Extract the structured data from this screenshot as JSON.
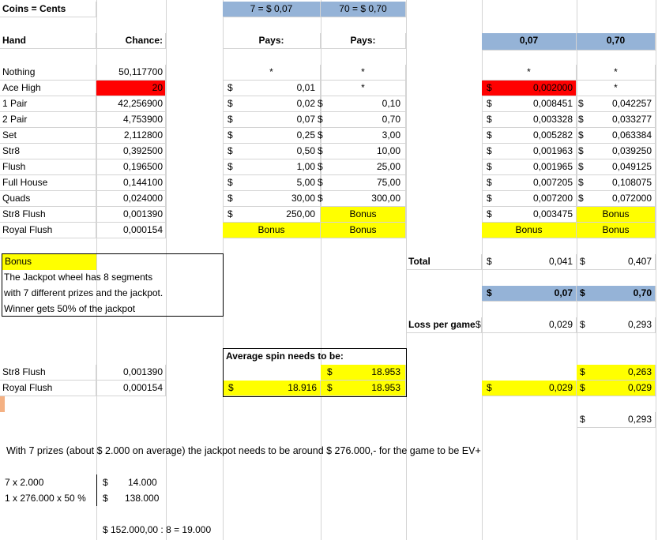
{
  "header": {
    "coins_label": "Coins = Cents",
    "rate_1": "7 = $ 0,07",
    "rate_2": "70 = $ 0,70"
  },
  "columns": {
    "hand": "Hand",
    "chance": "Chance:",
    "pays_1": "Pays:",
    "pays_2": "Pays:",
    "ev_1": "0,07",
    "ev_2": "0,70"
  },
  "rows": [
    {
      "hand": "Nothing",
      "chance": "50,117700",
      "pay1": "*",
      "pay2": "*",
      "ev1": "*",
      "ev2": "*"
    },
    {
      "hand": "Ace High",
      "chance": "20",
      "pay1": "0,01",
      "pay2": "*",
      "ev1": "0,002000",
      "ev2": "*"
    },
    {
      "hand": "1 Pair",
      "chance": "42,256900",
      "pay1": "0,02",
      "pay2": "0,10",
      "ev1": "0,008451",
      "ev2": "0,042257"
    },
    {
      "hand": "2 Pair",
      "chance": "4,753900",
      "pay1": "0,07",
      "pay2": "0,70",
      "ev1": "0,003328",
      "ev2": "0,033277"
    },
    {
      "hand": "Set",
      "chance": "2,112800",
      "pay1": "0,25",
      "pay2": "3,00",
      "ev1": "0,005282",
      "ev2": "0,063384"
    },
    {
      "hand": "Str8",
      "chance": "0,392500",
      "pay1": "0,50",
      "pay2": "10,00",
      "ev1": "0,001963",
      "ev2": "0,039250"
    },
    {
      "hand": "Flush",
      "chance": "0,196500",
      "pay1": "1,00",
      "pay2": "25,00",
      "ev1": "0,001965",
      "ev2": "0,049125"
    },
    {
      "hand": "Full House",
      "chance": "0,144100",
      "pay1": "5,00",
      "pay2": "75,00",
      "ev1": "0,007205",
      "ev2": "0,108075"
    },
    {
      "hand": "Quads",
      "chance": "0,024000",
      "pay1": "30,00",
      "pay2": "300,00",
      "ev1": "0,007200",
      "ev2": "0,072000"
    },
    {
      "hand": "Str8 Flush",
      "chance": "0,001390",
      "pay1": "250,00",
      "pay2": "Bonus",
      "ev1": "0,003475",
      "ev2": "Bonus"
    },
    {
      "hand": "Royal Flush",
      "chance": "0,000154",
      "pay1": "Bonus",
      "pay2": "Bonus",
      "ev1": "Bonus",
      "ev2": "Bonus"
    }
  ],
  "currency": "$",
  "bonus_box": {
    "title": "Bonus",
    "line1": "The Jackpot wheel has 8 segments",
    "line2": "with 7 different prizes and the jackpot.",
    "line3": "Winner gets 50% of the jackpot"
  },
  "totals": {
    "total_label": "Total",
    "total_1": "0,041",
    "total_2": "0,407",
    "bet_1": "0,07",
    "bet_2": "0,70",
    "loss_label": "Loss per game",
    "loss_1": "0,029",
    "loss_2": "0,293"
  },
  "spin": {
    "title": "Average spin needs to be:",
    "sf_hand": "Str8 Flush",
    "sf_chance": "0,001390",
    "sf_value": "18.953",
    "sf_ev2": "0,263",
    "rf_hand": "Royal Flush",
    "rf_chance": "0,000154",
    "rf_value_1": "18.916",
    "rf_value_2": "18.953",
    "rf_ev1": "0,029",
    "rf_ev2": "0,029",
    "sum_ev2": "0,293"
  },
  "note": "With 7 prizes (about $ 2.000 on average) the jackpot needs to be around $ 276.000,- for the game to be EV+",
  "calc": {
    "line1_label": "7 x 2.000",
    "line1_value": "14.000",
    "line2_label": "1 x 276.000 x 50 %",
    "line2_value": "138.000",
    "result": "$ 152.000,00 : 8 = 19.000"
  }
}
